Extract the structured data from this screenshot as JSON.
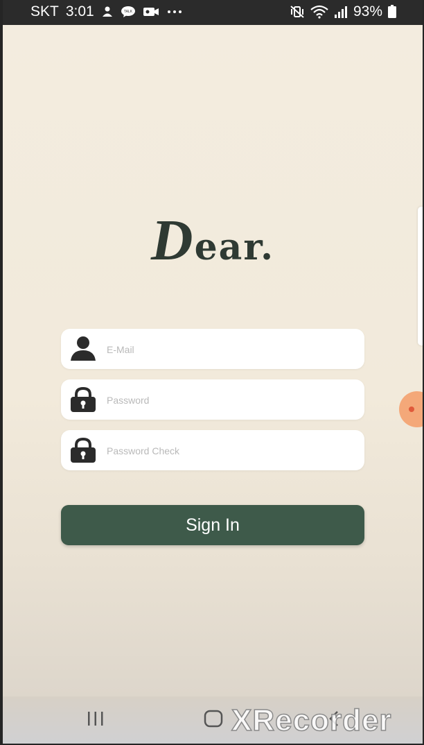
{
  "status_bar": {
    "carrier": "SKT",
    "time": "3:01",
    "left_icons": [
      "notification-person-icon",
      "talk-bubble-icon",
      "video-camera-icon",
      "more-dots-icon"
    ],
    "right_icons": [
      "mute-vibrate-icon",
      "wifi-icon",
      "signal-icon"
    ],
    "battery": "93%"
  },
  "app": {
    "logo": {
      "initial": "D",
      "rest": "ear."
    },
    "form": {
      "email_placeholder": "E-Mail",
      "password_placeholder": "Password",
      "password_check_placeholder": "Password Check",
      "submit_label": "Sign In"
    }
  },
  "nav_bar": {
    "buttons": [
      "recent-apps",
      "home",
      "back"
    ]
  },
  "watermark": "XRecorder",
  "colors": {
    "background": "#f3ecdf",
    "brand_green": "#3e5a4a",
    "logo_text": "#2f3a33",
    "icon_dark": "#2b2b2b",
    "placeholder": "#b9b9b9"
  }
}
